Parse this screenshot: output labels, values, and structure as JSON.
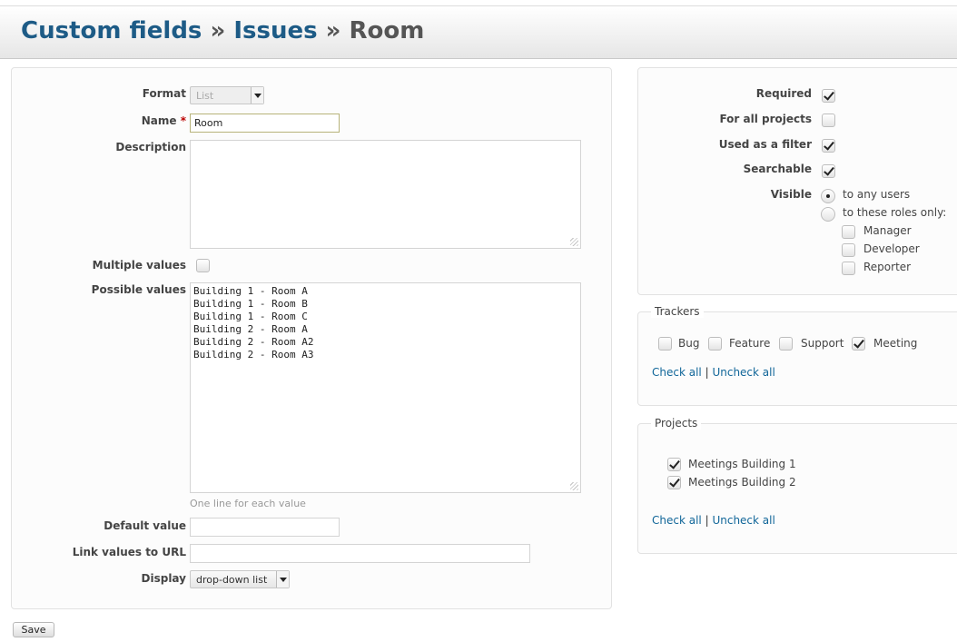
{
  "breadcrumb": {
    "items": [
      "Custom fields",
      "Issues"
    ],
    "separator": "»",
    "current": "Room"
  },
  "form": {
    "format": {
      "label": "Format",
      "value": "List"
    },
    "name": {
      "label": "Name",
      "required_mark": "*",
      "value": "Room"
    },
    "description": {
      "label": "Description",
      "value": ""
    },
    "multiple_values": {
      "label": "Multiple values",
      "checked": false
    },
    "possible_values": {
      "label": "Possible values",
      "value": "Building 1 - Room A\nBuilding 1 - Room B\nBuilding 1 - Room C\nBuilding 2 - Room A\nBuilding 2 - Room A2\nBuilding 2 - Room A3",
      "hint": "One line for each value"
    },
    "default_value": {
      "label": "Default value",
      "value": ""
    },
    "link_url": {
      "label": "Link values to URL",
      "value": ""
    },
    "display": {
      "label": "Display",
      "value": "drop-down list"
    }
  },
  "options": {
    "required": {
      "label": "Required",
      "checked": true
    },
    "for_all_projects": {
      "label": "For all projects",
      "checked": false
    },
    "used_as_filter": {
      "label": "Used as a filter",
      "checked": true
    },
    "searchable": {
      "label": "Searchable",
      "checked": true
    },
    "visible": {
      "label": "Visible",
      "any_users": "to any users",
      "these_roles": "to these roles only:",
      "selected": "any_users",
      "roles": [
        {
          "label": "Manager",
          "checked": false
        },
        {
          "label": "Developer",
          "checked": false
        },
        {
          "label": "Reporter",
          "checked": false
        }
      ]
    }
  },
  "trackers": {
    "legend": "Trackers",
    "items": [
      {
        "label": "Bug",
        "checked": false
      },
      {
        "label": "Feature",
        "checked": false
      },
      {
        "label": "Support",
        "checked": false
      },
      {
        "label": "Meeting",
        "checked": true
      }
    ],
    "check_all": "Check all",
    "divider": "|",
    "uncheck_all": "Uncheck all"
  },
  "projects": {
    "legend": "Projects",
    "items": [
      {
        "label": "Meetings Building 1",
        "checked": true
      },
      {
        "label": "Meetings Building 2",
        "checked": true
      }
    ],
    "check_all": "Check all",
    "divider": "|",
    "uncheck_all": "Uncheck all"
  },
  "save_label": "Save",
  "colors": {
    "link": "#1d5b86",
    "required": "#bb0000"
  }
}
